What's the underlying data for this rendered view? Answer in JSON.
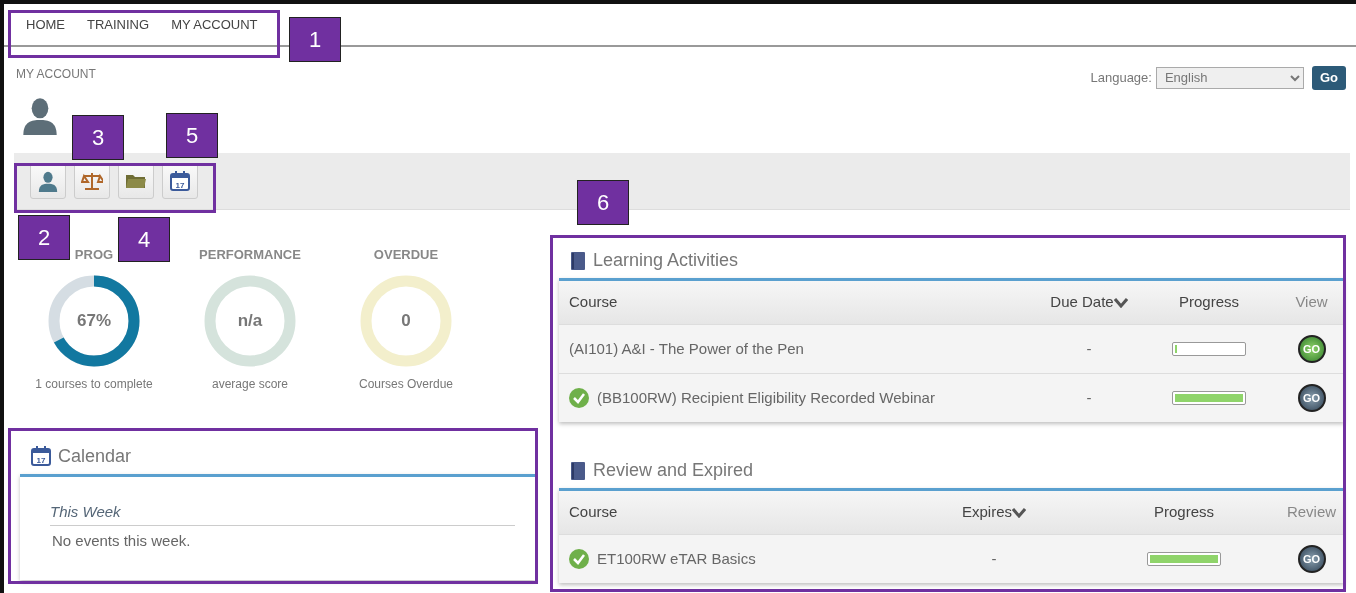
{
  "nav": {
    "items": [
      {
        "label": "HOME"
      },
      {
        "label": "TRAINING"
      },
      {
        "label": "MY ACCOUNT"
      }
    ]
  },
  "breadcrumb": "MY ACCOUNT",
  "language": {
    "label": "Language:",
    "value": "English",
    "button": "Go"
  },
  "toolbar": [
    {
      "kind": "person"
    },
    {
      "kind": "scales"
    },
    {
      "kind": "folder"
    },
    {
      "kind": "calendar",
      "day": "17"
    }
  ],
  "gauges": [
    {
      "title": "PROG",
      "value": "67%",
      "caption": "1 courses to complete",
      "color": "#1278a0",
      "level": 0.67
    },
    {
      "title": "PERFORMANCE",
      "value": "n/a",
      "caption": "average score",
      "color": "#d5e3dc"
    },
    {
      "title": "OVERDUE",
      "value": "0",
      "caption": "Courses Overdue",
      "color": "#f3efcc"
    }
  ],
  "calendar": {
    "title": "Calendar",
    "day": "17",
    "subheading": "This Week",
    "message": "No events this week."
  },
  "panels": [
    {
      "title": "Learning Activities",
      "columns": [
        {
          "label": "Course",
          "sortable": false
        },
        {
          "label": "Due Date",
          "sortable": true
        },
        {
          "label": "Progress",
          "sortable": false
        },
        {
          "label": "View",
          "sortable": false
        }
      ],
      "rows": [
        {
          "course": "(AI101) A&I - The Power of the Pen",
          "completed": false,
          "date": "-",
          "level": 0.03,
          "action": "GO"
        },
        {
          "course": "(BB100RW) Recipient Eligibility Recorded Webinar",
          "completed": true,
          "date": "-",
          "level": 1,
          "action": "GO"
        }
      ]
    },
    {
      "title": "Review and Expired",
      "columns": [
        {
          "label": "Course",
          "sortable": false
        },
        {
          "label": "Expires",
          "sortable": true
        },
        {
          "label": "Progress",
          "sortable": false
        },
        {
          "label": "Review",
          "sortable": false
        }
      ],
      "rows": [
        {
          "course": "ET100RW eTAR Basics",
          "completed": true,
          "date": "-",
          "level": 1,
          "action": "GO"
        }
      ]
    }
  ],
  "callouts": [
    {
      "label": "1"
    },
    {
      "label": "2"
    },
    {
      "label": "3"
    },
    {
      "label": "4"
    },
    {
      "label": "5"
    },
    {
      "label": "6"
    }
  ]
}
